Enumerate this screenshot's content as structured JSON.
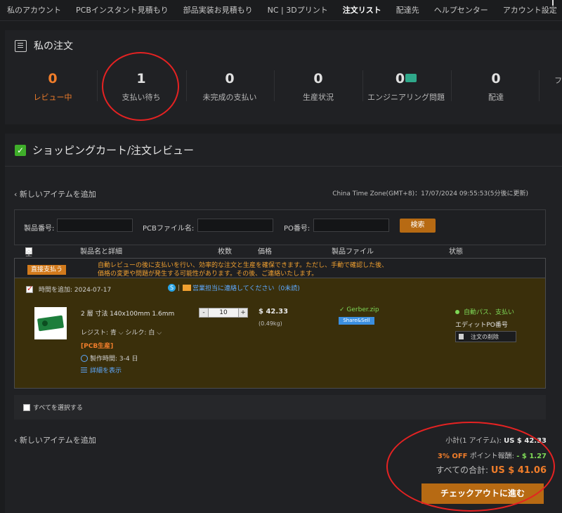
{
  "nav": {
    "items": [
      "私のアカウント",
      "PCBインスタント見積もり",
      "部品実装お見積もり",
      "NC | 3Dプリント",
      "注文リスト",
      "配達先",
      "ヘルプセンター",
      "アカウント設定"
    ],
    "active": "注文リスト"
  },
  "orders": {
    "title": "私の注文",
    "stats": [
      {
        "value": "0",
        "label": "レビュー中"
      },
      {
        "value": "1",
        "label": "支払い待ち"
      },
      {
        "value": "0",
        "label": "未完成の支払い"
      },
      {
        "value": "0",
        "label": "生産状況"
      },
      {
        "value": "0",
        "label": "エンジニアリング問題"
      },
      {
        "value": "0",
        "label": "配達"
      },
      {
        "value": "",
        "label": "フィ"
      }
    ]
  },
  "cart": {
    "title": "ショッピングカート/注文レビュー",
    "add_link": "‹ 新しいアイテムを追加",
    "timezone": "China Time Zone(GMT+8)：17/07/2024 09:55:53(5分後に更新)",
    "search": {
      "product_no_label": "製品番号:",
      "pcb_file_label": "PCBファイル名:",
      "po_label": "PO番号:",
      "button": "検索"
    },
    "headers": {
      "all": "全て",
      "name": "製品名と詳細",
      "qty": "枚数",
      "price": "価格",
      "file": "製品ファイル",
      "status": "状態"
    },
    "notice": {
      "badge": "直接支払う",
      "text": "自動レビューの後に支払いを行い、効率的な注文と生産を確保できます。ただし、手動で確認した後、価格の変更や問題が発生する可能性があります。その後、ご連絡いたします。"
    },
    "item": {
      "added": "時間を追加: 2024-07-17",
      "contact": "営業担当に連絡してください（0未読)",
      "name": "2 層 寸法 140x100mm 1.6mm",
      "options": "レジスト: 青 ⌵  シルク: 白 ⌵",
      "tag": "[PCB生産]",
      "lead_time": "製作時間: 3-4 日",
      "details": "詳細を表示",
      "qty": "10",
      "price": "$ 42.33",
      "weight": "(0.49kg)",
      "file": "Gerber.zip",
      "share": "Share&Sell",
      "status": "自動パス、支払い",
      "po": "エディットPO番号",
      "delete": "注文の削除"
    },
    "select_all": "すべてを選択する",
    "summary": {
      "subtotal_label": "小計(1 アイテム):",
      "subtotal": "US $ 42.33",
      "discount_pct": "3% OFF",
      "discount_label": "ポイント報酬:",
      "discount": "- $ 1.27",
      "total_label": "すべての合計:",
      "total": "US $ 41.06",
      "checkout": "チェックアウトに進む"
    }
  },
  "colors": {
    "accent": "#b76a13",
    "orange": "#f07d2a",
    "green": "#7ed957",
    "annotation": "#e52222"
  }
}
